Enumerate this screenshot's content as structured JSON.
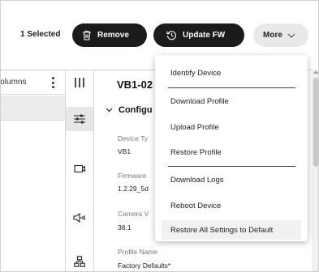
{
  "toolbar": {
    "selected_text": "1 Selected",
    "remove_label": "Remove",
    "update_fw_label": "Update FW",
    "more_label": "More",
    "remove_icon": "trash-icon",
    "update_icon": "clock-refresh-icon",
    "more_icon": "chevron-down-icon"
  },
  "left_panel": {
    "columns_label": "Columns"
  },
  "icon_rail": [
    {
      "name": "columns-view-icon"
    },
    {
      "name": "sliders-icon"
    },
    {
      "name": "camera-icon"
    },
    {
      "name": "speaker-icon"
    },
    {
      "name": "network-icon"
    }
  ],
  "details": {
    "device_title": "VB1-02",
    "section_title": "Configu",
    "fields": [
      {
        "label": "Device Ty",
        "value": "VB1"
      },
      {
        "label": "Firmware",
        "value": "1.2.29_5d"
      },
      {
        "label": "Camera V",
        "value": "38.1"
      },
      {
        "label": "Profile Name",
        "value": "Factory Defaults*"
      }
    ]
  },
  "menu": {
    "items": [
      {
        "label": "Identify Device"
      },
      {
        "label": "Download Profile"
      },
      {
        "label": "Upload Profile"
      },
      {
        "label": "Restore Profile"
      },
      {
        "label": "Download Logs"
      },
      {
        "label": "Reboot Device"
      },
      {
        "label": "Restore All Settings to Default"
      }
    ]
  },
  "colors": {
    "dark_button": "#1b1b1b",
    "light_button": "#e9e9e9",
    "highlight": "#f1f1f1"
  }
}
